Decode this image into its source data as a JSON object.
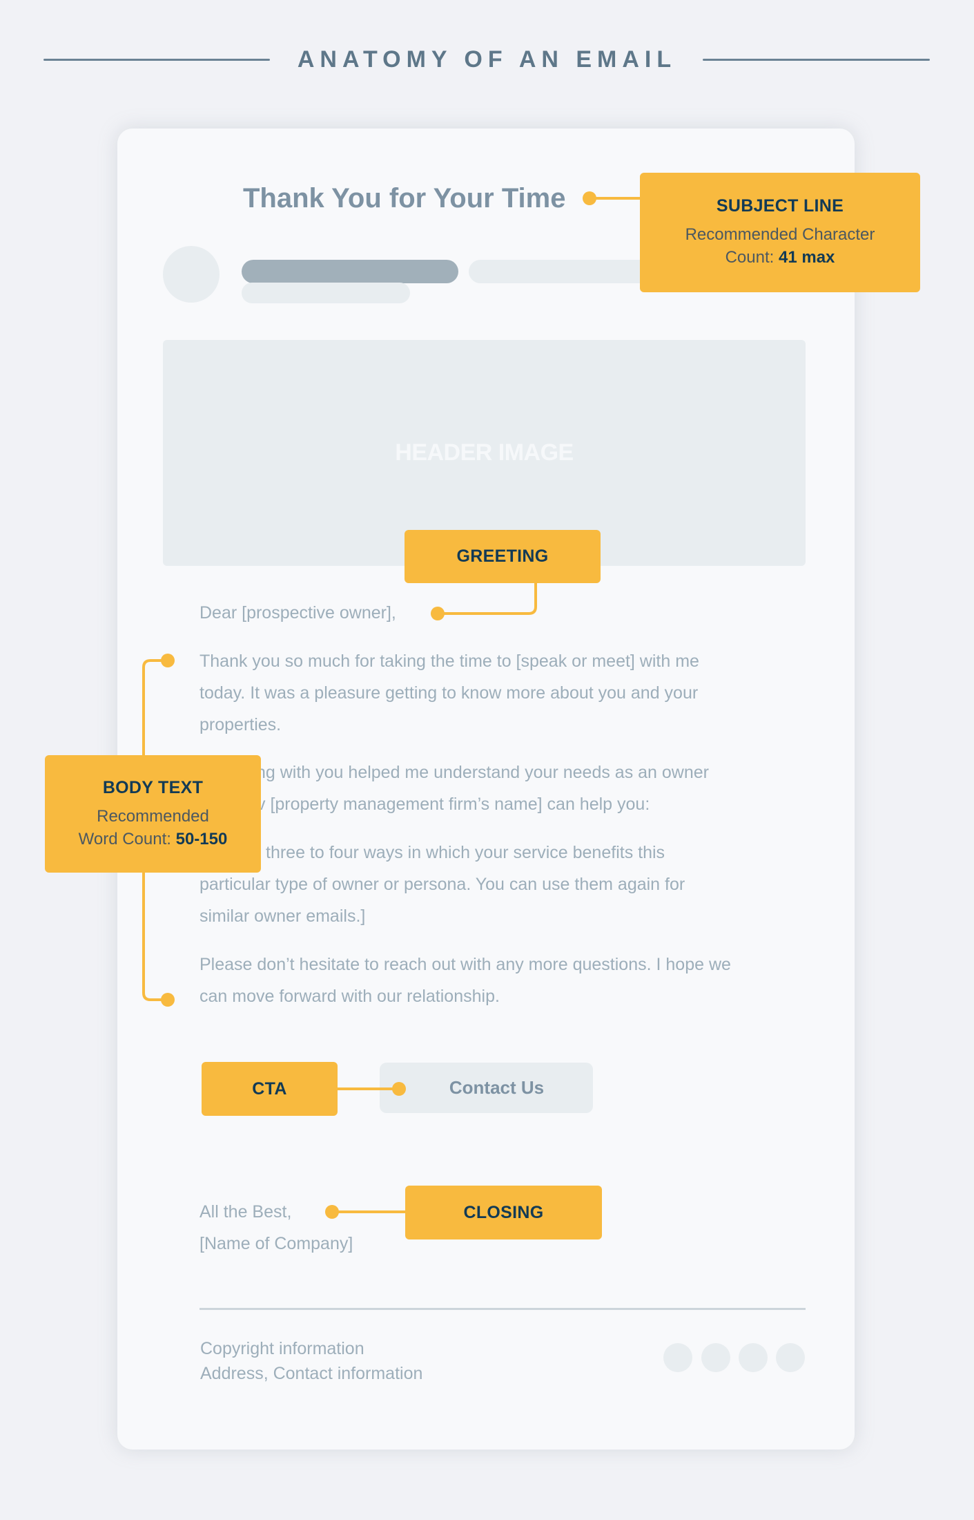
{
  "page": {
    "title": "ANATOMY OF AN EMAIL"
  },
  "colors": {
    "background": "#F1F2F6",
    "card": "#F8F9FB",
    "accent": "#F8BA3F",
    "callout_title": "#123A55",
    "title": "#5E7789",
    "muted_text": "#9DAEBA",
    "placeholder": "#E8EDF0"
  },
  "email": {
    "subject": "Thank You for Your Time",
    "header_image_label": "HEADER IMAGE",
    "greeting": "Dear [prospective owner],",
    "body": [
      {
        "lines": [
          "Thank you so much for taking the time to [speak or meet] with me",
          "today. It was a pleasure getting to know more about you and your",
          "properties."
        ]
      },
      {
        "lines": [
          "ng with you helped me understand your needs as an owner",
          "v [property management firm’s name] can help you:"
        ],
        "partially_hidden": true
      },
      {
        "lines": [
          "three to four ways in which your service benefits this",
          "particular type of owner or persona. You can use them again for",
          "similar owner emails.]"
        ],
        "partially_hidden": true
      },
      {
        "lines": [
          "Please don’t hesitate to reach out with any more questions. I hope we",
          "can move forward with our relationship."
        ]
      }
    ],
    "cta_button": "Contact Us",
    "closing": [
      "All the Best,",
      "[Name of Company]"
    ],
    "footer": {
      "line1": "Copyright information",
      "line2": "Address, Contact information",
      "social_icons": [
        "social-icon",
        "social-icon",
        "social-icon",
        "social-icon"
      ]
    }
  },
  "callouts": {
    "subject_line": {
      "title": "SUBJECT LINE",
      "desc_prefix": "Recommended Character",
      "desc_label": "Count:",
      "desc_value": "41 max"
    },
    "greeting": {
      "title": "GREETING"
    },
    "body_text": {
      "title": "BODY TEXT",
      "desc_prefix": "Recommended",
      "desc_label": "Word Count:",
      "desc_value": "50-150"
    },
    "cta": {
      "title": "CTA"
    },
    "closing": {
      "title": "CLOSING"
    }
  }
}
